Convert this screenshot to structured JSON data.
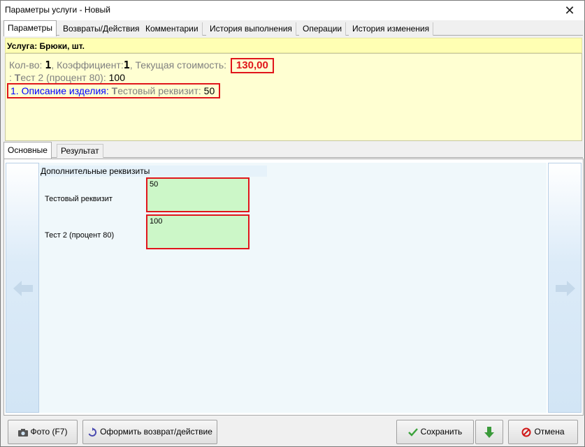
{
  "window": {
    "title": "Параметры услуги - Новый",
    "close_glyph": "✕"
  },
  "tabs": [
    {
      "label": "Параметры",
      "active": true
    },
    {
      "label": "Возвраты/Действия"
    },
    {
      "label": "Комментарии"
    },
    {
      "label": "История выполнения"
    },
    {
      "label": "Операции"
    },
    {
      "label": "История изменения"
    }
  ],
  "info": {
    "header": "Услуга: Брюки, шт.",
    "qty_label": "Кол-во: ",
    "qty_value": "1",
    "coef_label": ", Коэффициент:",
    "coef_value": "1",
    "cost_label": ", Текущая стоимость:",
    "cost_value": "130,00",
    "line2_prefix": ": ",
    "line2_bold": "Т",
    "line2_label": "ест 2 (процент 80): ",
    "line2_value": "100",
    "line3_blue": "1. Описание изделия: ",
    "line3_bold": "Т",
    "line3_label": "естовый реквизит: ",
    "line3_value": "50",
    "cost_color": "#e0151b"
  },
  "subtabs": [
    {
      "label": "Основные",
      "active": true
    },
    {
      "label": "Результат"
    }
  ],
  "details": {
    "section_title": "Дополнительные реквизиты",
    "fields": [
      {
        "label": "Тестовый реквизит",
        "value": "50"
      },
      {
        "label": "Тест 2 (процент 80)",
        "value": "100"
      }
    ],
    "field_bg": "#ccf7c8"
  },
  "nav": {
    "prev_icon": "arrow-left-icon",
    "next_icon": "arrow-right-icon"
  },
  "buttons": {
    "photo": "Фото (F7)",
    "return": "Оформить возврат/действие",
    "save": "Сохранить",
    "cancel": "Отмена"
  }
}
